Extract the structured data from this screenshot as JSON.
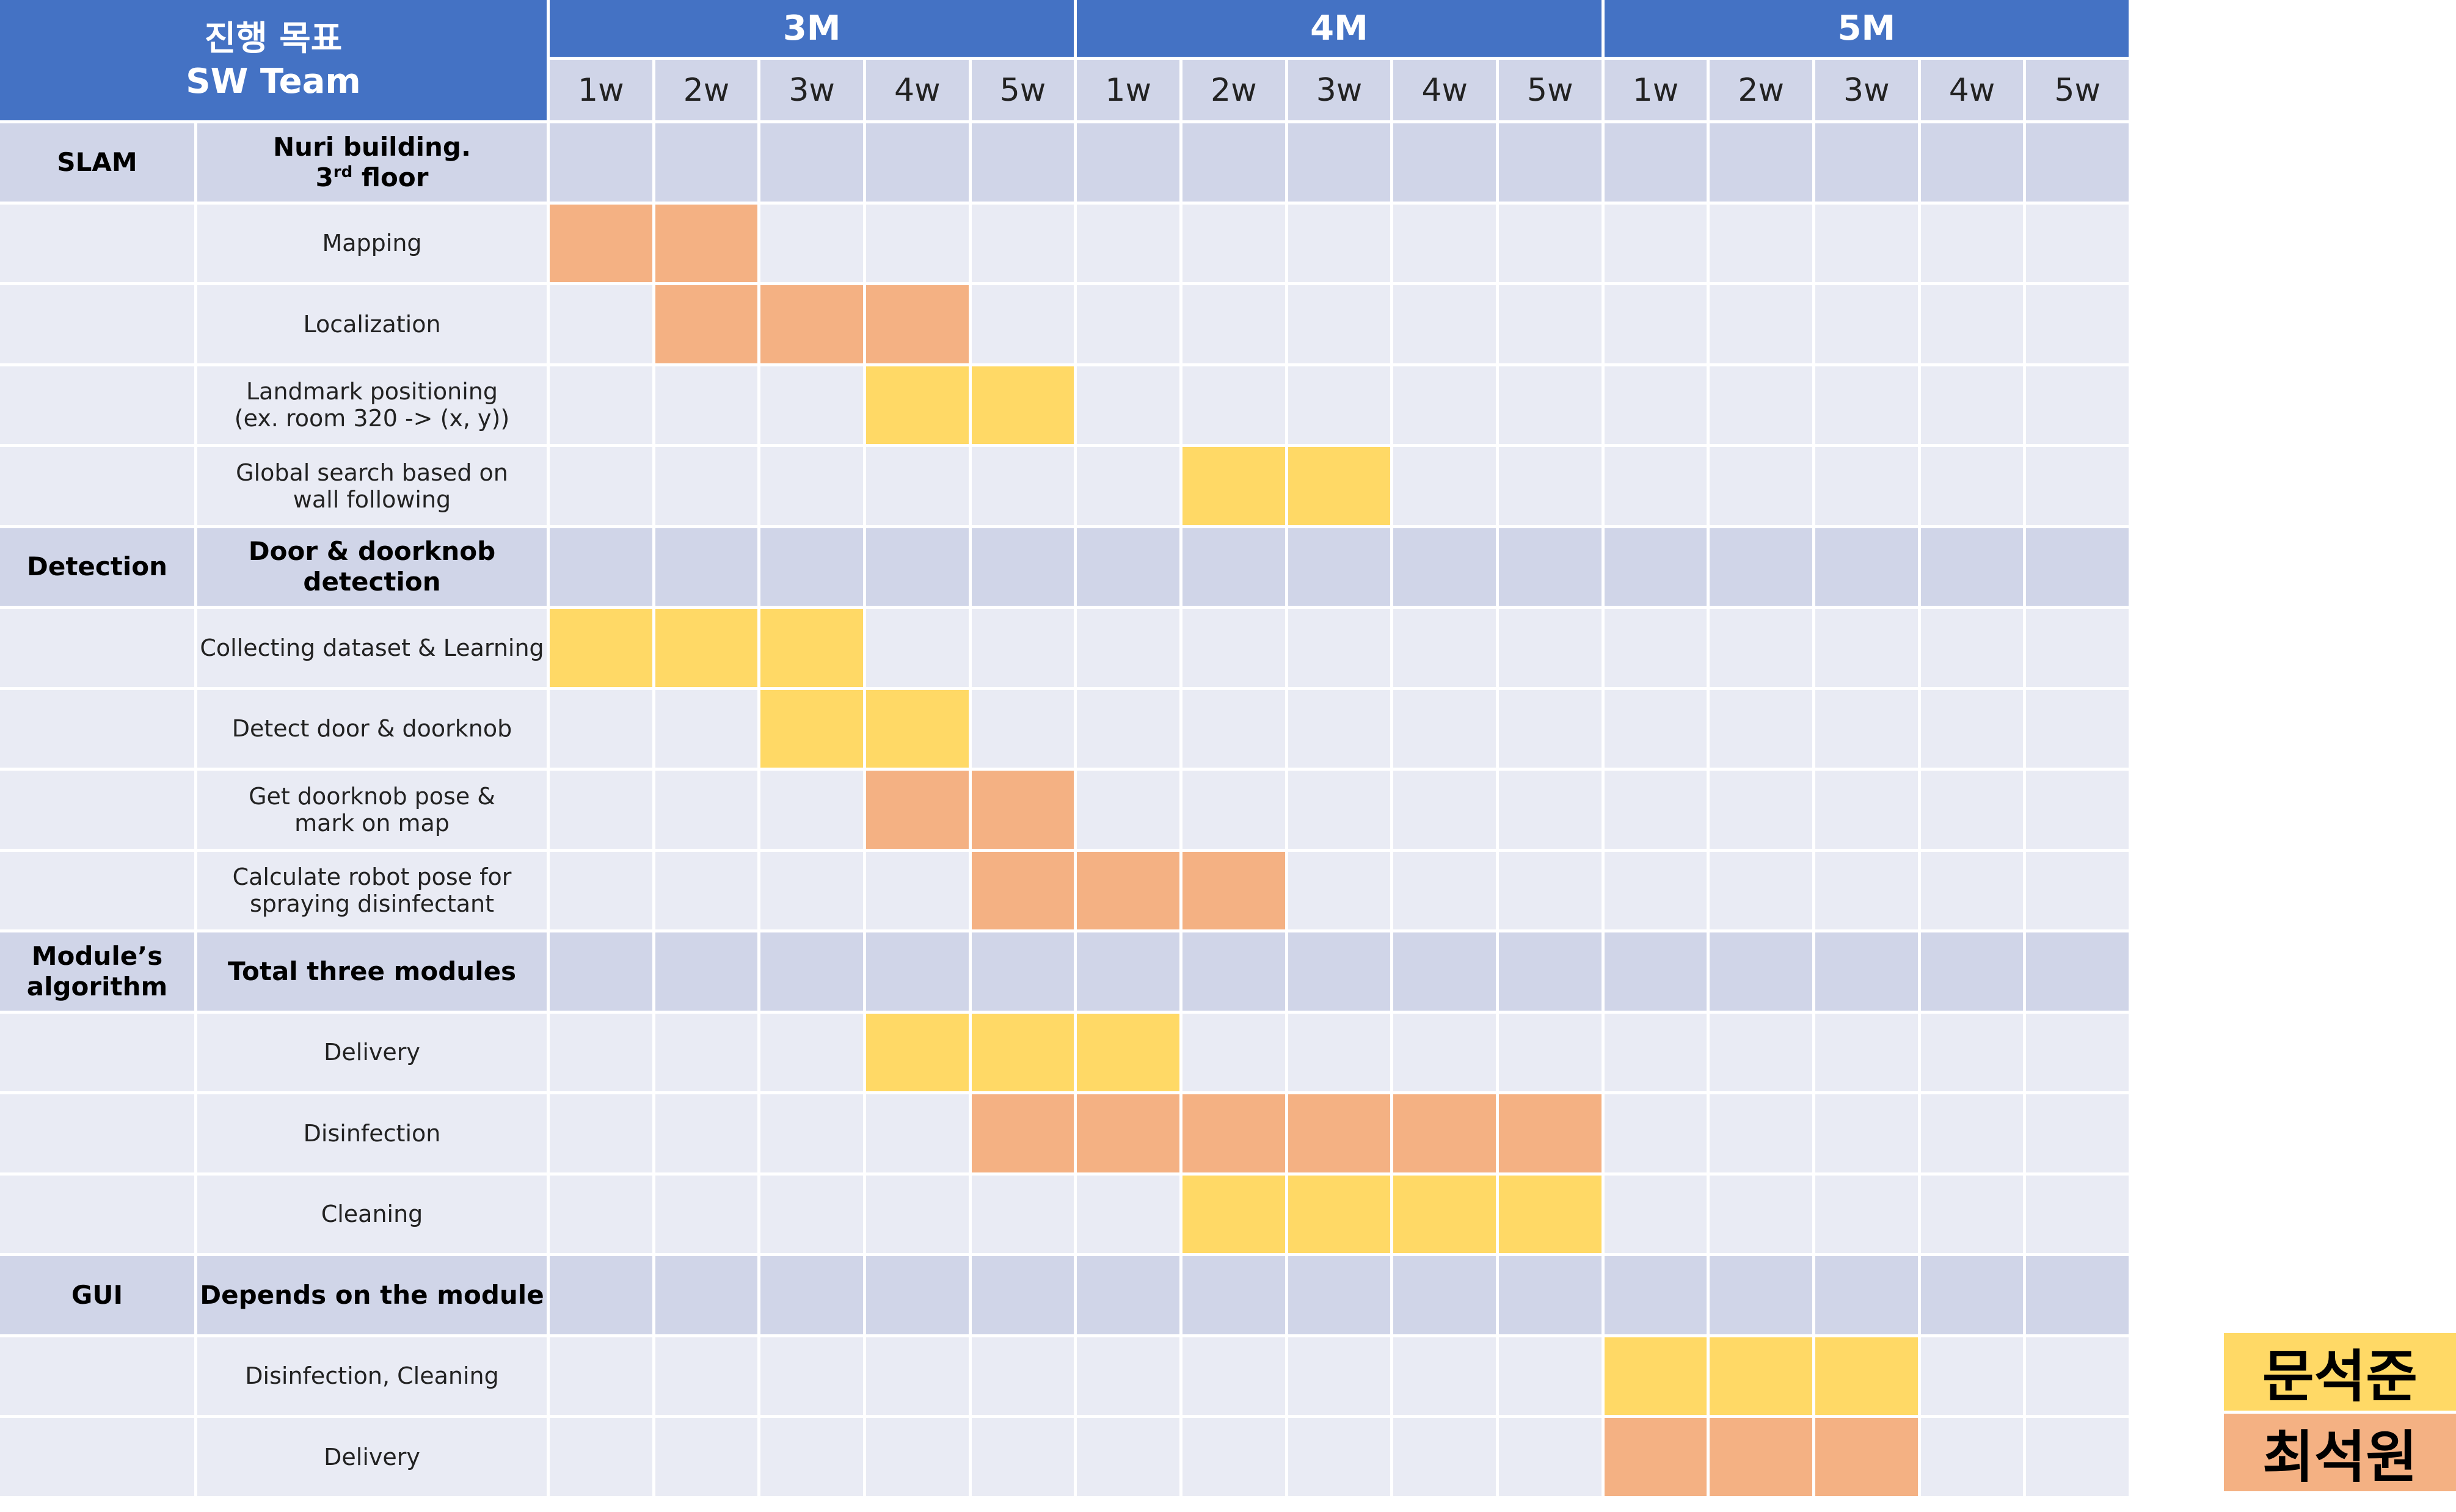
{
  "header": {
    "title_line1": "진행 목표",
    "title_line2": "SW Team"
  },
  "colors": {
    "header_blue": "#4472C4",
    "category_row": "#D0D5E8",
    "task_row": "#E9EBF4",
    "yellow": "#FFD966",
    "orange": "#F4B183",
    "grid_line": "#FFFFFF"
  },
  "chart_data": {
    "type": "table",
    "months": [
      "3M",
      "4M",
      "5M"
    ],
    "weeks": [
      "1w",
      "2w",
      "3w",
      "4w",
      "5w"
    ],
    "legend": [
      {
        "name": "문석준",
        "color": "yellow"
      },
      {
        "name": "최석원",
        "color": "orange"
      }
    ],
    "rows": [
      {
        "kind": "category",
        "category": "SLAM",
        "task": "Nuri building.\n3rd floor",
        "bars": []
      },
      {
        "kind": "task",
        "category": "",
        "task": "Mapping",
        "bars": [
          {
            "start": 1,
            "end": 2,
            "color": "orange"
          }
        ]
      },
      {
        "kind": "task",
        "category": "",
        "task": "Localization",
        "bars": [
          {
            "start": 2,
            "end": 4,
            "color": "orange"
          }
        ]
      },
      {
        "kind": "task",
        "category": "",
        "task": "Landmark positioning\n(ex. room 320 -> (x, y))",
        "bars": [
          {
            "start": 4,
            "end": 5,
            "color": "yellow"
          }
        ]
      },
      {
        "kind": "task",
        "category": "",
        "task": "Global search based on\nwall following",
        "bars": [
          {
            "start": 7,
            "end": 8,
            "color": "yellow"
          }
        ]
      },
      {
        "kind": "category",
        "category": "Detection",
        "task": "Door & doorknob\ndetection",
        "bars": []
      },
      {
        "kind": "task",
        "category": "",
        "task": "Collecting dataset & Learning",
        "bars": [
          {
            "start": 1,
            "end": 3,
            "color": "yellow"
          }
        ]
      },
      {
        "kind": "task",
        "category": "",
        "task": "Detect door & doorknob",
        "bars": [
          {
            "start": 3,
            "end": 4,
            "color": "yellow"
          }
        ]
      },
      {
        "kind": "task",
        "category": "",
        "task": "Get doorknob pose &\nmark on map",
        "bars": [
          {
            "start": 4,
            "end": 5,
            "color": "orange"
          }
        ]
      },
      {
        "kind": "task",
        "category": "",
        "task": "Calculate robot pose for\nspraying disinfectant",
        "bars": [
          {
            "start": 5,
            "end": 7,
            "color": "orange"
          }
        ]
      },
      {
        "kind": "category",
        "category": "Module’s\nalgorithm",
        "task": "Total three modules",
        "bars": []
      },
      {
        "kind": "task",
        "category": "",
        "task": "Delivery",
        "bars": [
          {
            "start": 4,
            "end": 6,
            "color": "yellow"
          }
        ]
      },
      {
        "kind": "task",
        "category": "",
        "task": "Disinfection",
        "bars": [
          {
            "start": 5,
            "end": 10,
            "color": "orange"
          }
        ]
      },
      {
        "kind": "task",
        "category": "",
        "task": "Cleaning",
        "bars": [
          {
            "start": 7,
            "end": 10,
            "color": "yellow"
          }
        ]
      },
      {
        "kind": "category",
        "category": "GUI",
        "task": "Depends on the module",
        "bars": []
      },
      {
        "kind": "task",
        "category": "",
        "task": "Disinfection, Cleaning",
        "bars": [
          {
            "start": 11,
            "end": 13,
            "color": "yellow"
          }
        ]
      },
      {
        "kind": "task",
        "category": "",
        "task": "Delivery",
        "bars": [
          {
            "start": 11,
            "end": 13,
            "color": "orange"
          }
        ]
      }
    ]
  }
}
